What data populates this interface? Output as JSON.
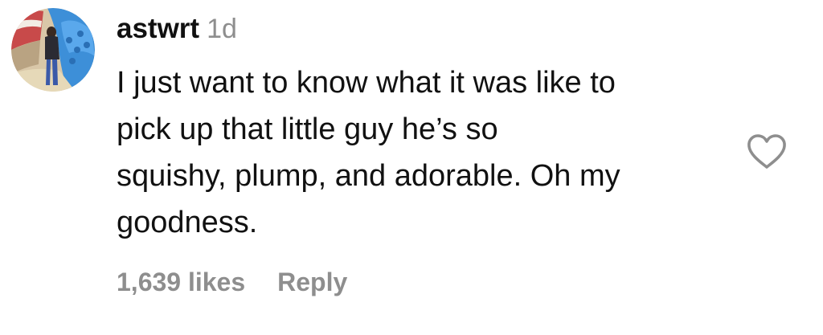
{
  "comment": {
    "username": "astwrt",
    "timestamp": "1d",
    "text_lines": [
      "I just want to know what it was like to",
      "pick up that little guy he’s so",
      "squishy, plump, and adorable. Oh my",
      "goodness."
    ],
    "likes_label": "1,639 likes",
    "reply_label": "Reply",
    "avatar_icon": "user-avatar-photo",
    "like_icon": "heart-outline-icon"
  },
  "colors": {
    "primary_text": "#111111",
    "secondary_text": "#8e8e8e",
    "background": "#ffffff",
    "heart_stroke": "#8e8e8e"
  }
}
